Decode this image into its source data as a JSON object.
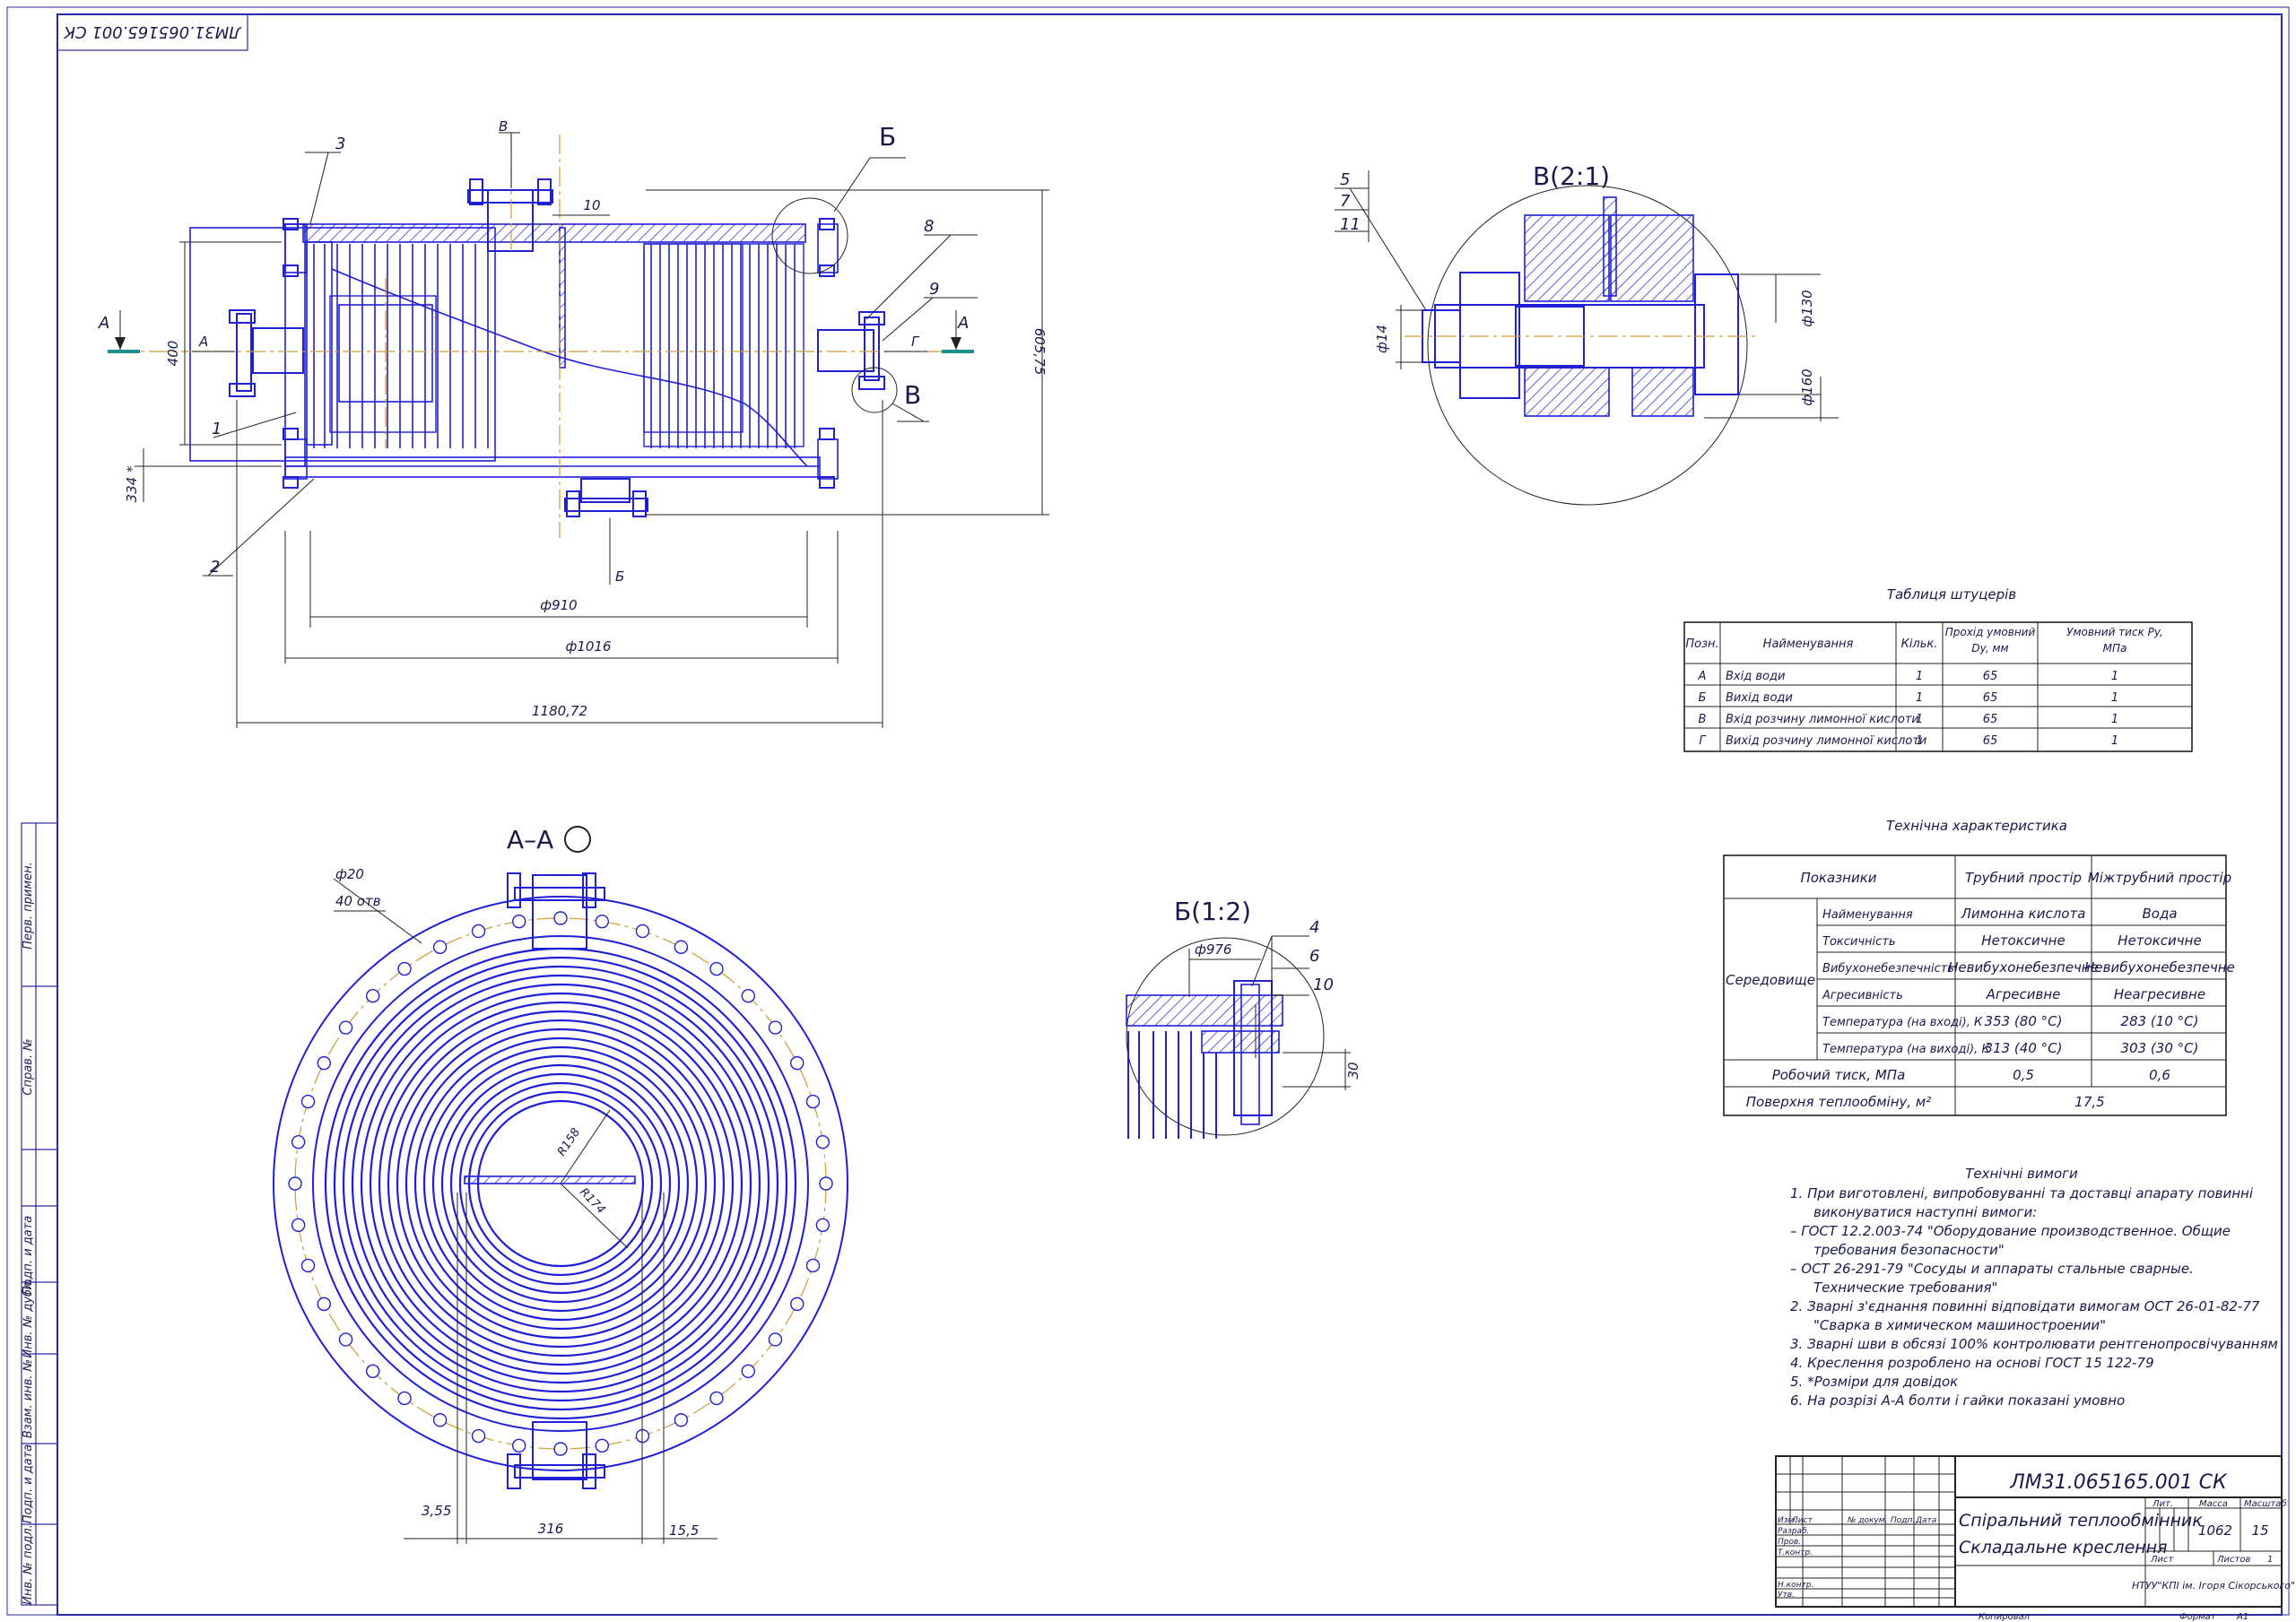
{
  "drawing": {
    "code_rotated": "ЛМ31.065165.001 СК",
    "colors": {
      "frame": "#2a2aa6",
      "lines": "#1f1fd6",
      "axis": "#d09a30",
      "text": "#1a1a4a"
    }
  },
  "main_view": {
    "position_labels": [
      "3",
      "1",
      "2",
      "8",
      "9"
    ],
    "nozzle_labels": {
      "a": "А",
      "b": "Б",
      "v": "В",
      "g": "Г"
    },
    "detail_callouts": {
      "b": "Б",
      "v": "В"
    },
    "section_marks": [
      "А",
      "А"
    ],
    "dimensions": {
      "d910": "ф910",
      "d1016": "ф1016",
      "length": "1180,72",
      "height_left": "400",
      "height_left2": "334 *",
      "height_right": "605,75",
      "gap_top": "10"
    }
  },
  "section_aa": {
    "title": "А–А",
    "holes_d": "ф20",
    "holes_n": "40 отв",
    "r_inner": "R158",
    "r_outer": "R174",
    "dim_left": "3,55",
    "dim_mid": "316",
    "dim_right": "15,5"
  },
  "detail_v": {
    "title": "В(2:1)",
    "positions": [
      "5",
      "7",
      "11"
    ],
    "d14": "ф14",
    "d130": "ф130",
    "d160": "ф160"
  },
  "detail_b": {
    "title": "Б(1:2)",
    "positions": [
      "4",
      "6",
      "10"
    ],
    "d976": "ф976",
    "h30": "30"
  },
  "nozzle_table": {
    "title": "Таблиця штуцерів",
    "headers": [
      "Позн.",
      "Найменування",
      "Кільк.",
      "Прохід умовний Dy, мм",
      "Умовний тиск Py, МПа"
    ],
    "rows": [
      [
        "А",
        "Вхід води",
        "1",
        "65",
        "1"
      ],
      [
        "Б",
        "Вихід води",
        "1",
        "65",
        "1"
      ],
      [
        "В",
        "Вхід розчину лимонної кислоти",
        "1",
        "65",
        "1"
      ],
      [
        "Г",
        "Вихід розчину лимонної кислоти",
        "1",
        "65",
        "1"
      ]
    ]
  },
  "tech_char": {
    "title": "Технічна характеристика",
    "headers": [
      "Показники",
      "Трубний простір",
      "Міжтрубний простір"
    ],
    "group": "Середовище",
    "rows": [
      [
        "Найменування",
        "Лимонна кислота",
        "Вода"
      ],
      [
        "Токсичність",
        "Нетоксичне",
        "Нетоксичне"
      ],
      [
        "Вибухонебезпечність",
        "Невибухонебезпечне",
        "Невибухонебезпечне"
      ],
      [
        "Агресивність",
        "Агресивне",
        "Неагресивне"
      ],
      [
        "Температура (на вході), К",
        "353 (80 °С)",
        "283 (10 °С)"
      ],
      [
        "Температура (на виході), К",
        "313 (40 °С)",
        "303 (30 °С)"
      ]
    ],
    "pressure": [
      "Робочий тиск, МПа",
      "0,5",
      "0,6"
    ],
    "surface": [
      "Поверхня теплообміну, м²",
      "17,5"
    ]
  },
  "tech_req": {
    "title": "Технічні вимоги",
    "lines": [
      "1. При виготовлені, випробовуванні та доставці апарату повинні",
      "виконуватися наступні вимоги:",
      "– ГОСТ 12.2.003-74 \"Оборудование производственное. Общие",
      "требования безопасности\"",
      "– ОСТ 26-291-79 \"Сосуды и аппараты стальные сварные.",
      "Технические требования\"",
      "2. Зварні з'єднання повинні відповідати вимогам ОСТ 26-01-82-77",
      "\"Сварка в химическом машиностроении\"",
      "3. Зварні шви в обсязі 100% контролювати рентгенопросвічуванням",
      "4. Креслення розроблено на основі ГОСТ 15 122-79",
      "5. *Розміри для довідок",
      "6. На розрізі А-А болти і гайки показані умовно"
    ]
  },
  "title_block": {
    "code": "ЛМ31.065165.001 СК",
    "name_line1": "Спіральний теплообмінник",
    "name_line2": "Складальне креслення",
    "col_labels": [
      "Изм.",
      "Лист",
      "№ докум.",
      "Подп.",
      "Дата"
    ],
    "row_labels": [
      "Разраб.",
      "Пров.",
      "Т.контр.",
      "Н.контр.",
      "Утв."
    ],
    "lit_label": "Лит.",
    "mass_label": "Масса",
    "scale_label": "Масштаб",
    "mass": "1062",
    "scale": "15",
    "sheet_label": "Лист",
    "sheets_label": "Листов",
    "sheets": "1",
    "org": "НТУУ\"КПІ ім. Ігоря Сікорського\"",
    "copied": "Копировал",
    "format_label": "Формат",
    "format": "А1"
  },
  "side_stamps": [
    "Перв. примен.",
    "Справ. №",
    "Подп. и дата",
    "Инв. № дубл.",
    "Взам. инв. №",
    "Подп. и дата",
    "Инв. № подл."
  ]
}
